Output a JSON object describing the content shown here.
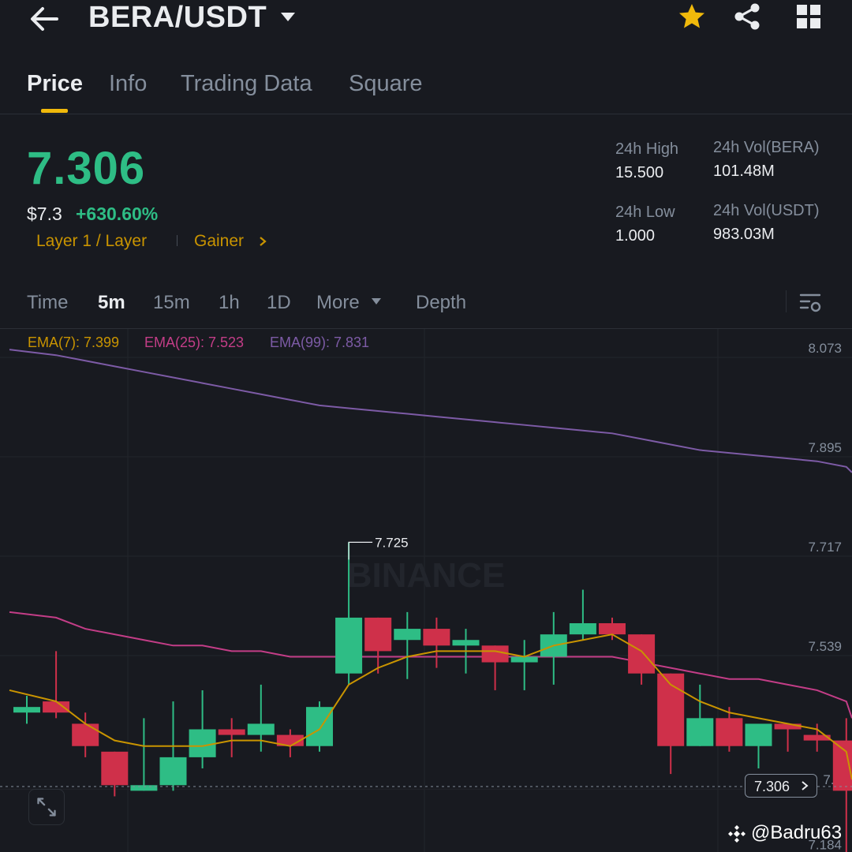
{
  "header": {
    "title": "BERA/USDT",
    "icons": [
      "back-arrow-icon",
      "chevron-down-icon",
      "star-icon",
      "share-icon",
      "grid-icon"
    ],
    "accent": "#f0b90b"
  },
  "tabs": [
    {
      "label": "Price",
      "active": true
    },
    {
      "label": "Info"
    },
    {
      "label": "Trading Data"
    },
    {
      "label": "Square"
    }
  ],
  "price": {
    "last": "7.306",
    "usd": "$7.3",
    "change": "+630.60%",
    "tag_sector": "Layer 1 / Layer",
    "tag_gainer": "Gainer",
    "up_color": "#2ebd85",
    "down_color": "#cf304a"
  },
  "stats": {
    "high_label": "24h High",
    "high_value": "15.500",
    "low_label": "24h Low",
    "low_value": "1.000",
    "vol_base_label": "24h Vol(BERA)",
    "vol_base_value": "101.48M",
    "vol_quote_label": "24h Vol(USDT)",
    "vol_quote_value": "983.03M"
  },
  "intervals": {
    "time": "Time",
    "m5": "5m",
    "m15": "15m",
    "h1": "1h",
    "d1": "1D",
    "more": "More",
    "depth": "Depth",
    "selected": "5m"
  },
  "ema_legend": {
    "ema7": "EMA(7): 7.399",
    "ema25": "EMA(25): 7.523",
    "ema99": "EMA(99): 7.831"
  },
  "chart_data": {
    "type": "candlestick",
    "y_ticks": [
      "8.073",
      "7.895",
      "7.717",
      "7.539",
      "7.3",
      "7.184"
    ],
    "ylim": [
      7.16,
      8.1
    ],
    "max_marker": "7.725",
    "current_price_label": "7.306",
    "watermark": "BINANCE",
    "candles": [
      {
        "o": 7.42,
        "h": 7.45,
        "l": 7.4,
        "c": 7.43
      },
      {
        "o": 7.44,
        "h": 7.53,
        "l": 7.41,
        "c": 7.42
      },
      {
        "o": 7.4,
        "h": 7.42,
        "l": 7.34,
        "c": 7.36
      },
      {
        "o": 7.35,
        "h": 7.35,
        "l": 7.27,
        "c": 7.29
      },
      {
        "o": 7.28,
        "h": 7.41,
        "l": 7.28,
        "c": 7.29
      },
      {
        "o": 7.29,
        "h": 7.44,
        "l": 7.28,
        "c": 7.34
      },
      {
        "o": 7.34,
        "h": 7.46,
        "l": 7.32,
        "c": 7.39
      },
      {
        "o": 7.39,
        "h": 7.41,
        "l": 7.34,
        "c": 7.38
      },
      {
        "o": 7.38,
        "h": 7.47,
        "l": 7.35,
        "c": 7.4
      },
      {
        "o": 7.38,
        "h": 7.39,
        "l": 7.34,
        "c": 7.36
      },
      {
        "o": 7.36,
        "h": 7.44,
        "l": 7.35,
        "c": 7.43
      },
      {
        "o": 7.49,
        "h": 7.725,
        "l": 7.47,
        "c": 7.59
      },
      {
        "o": 7.59,
        "h": 7.59,
        "l": 7.49,
        "c": 7.53
      },
      {
        "o": 7.55,
        "h": 7.6,
        "l": 7.48,
        "c": 7.57
      },
      {
        "o": 7.57,
        "h": 7.59,
        "l": 7.5,
        "c": 7.54
      },
      {
        "o": 7.54,
        "h": 7.57,
        "l": 7.49,
        "c": 7.55
      },
      {
        "o": 7.54,
        "h": 7.54,
        "l": 7.46,
        "c": 7.51
      },
      {
        "o": 7.51,
        "h": 7.55,
        "l": 7.46,
        "c": 7.52
      },
      {
        "o": 7.52,
        "h": 7.6,
        "l": 7.47,
        "c": 7.56
      },
      {
        "o": 7.56,
        "h": 7.64,
        "l": 7.55,
        "c": 7.58
      },
      {
        "o": 7.58,
        "h": 7.59,
        "l": 7.55,
        "c": 7.56
      },
      {
        "o": 7.56,
        "h": 7.56,
        "l": 7.47,
        "c": 7.49
      },
      {
        "o": 7.49,
        "h": 7.49,
        "l": 7.31,
        "c": 7.36
      },
      {
        "o": 7.36,
        "h": 7.47,
        "l": 7.36,
        "c": 7.41
      },
      {
        "o": 7.41,
        "h": 7.43,
        "l": 7.35,
        "c": 7.36
      },
      {
        "o": 7.36,
        "h": 7.39,
        "l": 7.32,
        "c": 7.4
      },
      {
        "o": 7.4,
        "h": 7.4,
        "l": 7.35,
        "c": 7.39
      },
      {
        "o": 7.38,
        "h": 7.4,
        "l": 7.35,
        "c": 7.37
      },
      {
        "o": 7.37,
        "h": 7.41,
        "l": 7.17,
        "c": 7.28
      }
    ],
    "ema7": [
      7.46,
      7.44,
      7.4,
      7.37,
      7.36,
      7.36,
      7.36,
      7.37,
      7.37,
      7.36,
      7.39,
      7.47,
      7.5,
      7.52,
      7.53,
      7.53,
      7.53,
      7.52,
      7.54,
      7.55,
      7.56,
      7.53,
      7.47,
      7.44,
      7.42,
      7.41,
      7.4,
      7.39,
      7.35
    ],
    "ema25": [
      7.6,
      7.59,
      7.57,
      7.56,
      7.55,
      7.54,
      7.54,
      7.53,
      7.53,
      7.52,
      7.52,
      7.52,
      7.52,
      7.52,
      7.52,
      7.52,
      7.52,
      7.52,
      7.52,
      7.52,
      7.52,
      7.51,
      7.5,
      7.49,
      7.48,
      7.48,
      7.47,
      7.46,
      7.44
    ],
    "ema99": [
      8.07,
      8.06,
      8.05,
      8.04,
      8.03,
      8.02,
      8.01,
      8.0,
      7.99,
      7.98,
      7.97,
      7.965,
      7.96,
      7.955,
      7.95,
      7.945,
      7.94,
      7.935,
      7.93,
      7.925,
      7.92,
      7.91,
      7.9,
      7.89,
      7.885,
      7.88,
      7.875,
      7.87,
      7.86
    ]
  },
  "watermark_text": "@Badru63"
}
